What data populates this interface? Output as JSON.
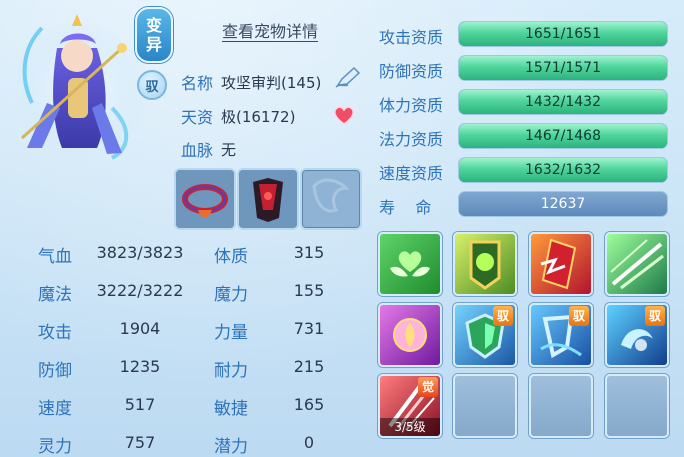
{
  "pet": {
    "variant_badge": [
      "变",
      "异"
    ],
    "tame_badge": "驭",
    "detail_link": "查看宠物详情",
    "name_label": "名称",
    "name_value": "攻坚审判(145)",
    "talent_label": "天资",
    "talent_value": "极(16172)",
    "bloodline_label": "血脉",
    "bloodline_value": "无"
  },
  "stats": {
    "left": [
      {
        "label": "气血",
        "value": "3823/3823"
      },
      {
        "label": "魔法",
        "value": "3222/3222"
      },
      {
        "label": "攻击",
        "value": "1904"
      },
      {
        "label": "防御",
        "value": "1235"
      },
      {
        "label": "速度",
        "value": "517"
      },
      {
        "label": "灵力",
        "value": "757"
      }
    ],
    "right": [
      {
        "label": "体质",
        "value": "315"
      },
      {
        "label": "魔力",
        "value": "155"
      },
      {
        "label": "力量",
        "value": "731"
      },
      {
        "label": "耐力",
        "value": "215"
      },
      {
        "label": "敏捷",
        "value": "165"
      },
      {
        "label": "潜力",
        "value": "0"
      }
    ]
  },
  "aptitudes": [
    {
      "label": "攻击资质",
      "text": "1651/1651",
      "fill": 1.0
    },
    {
      "label": "防御资质",
      "text": "1571/1571",
      "fill": 1.0
    },
    {
      "label": "体力资质",
      "text": "1432/1432",
      "fill": 1.0
    },
    {
      "label": "法力资质",
      "text": "1467/1468",
      "fill": 0.999
    },
    {
      "label": "速度资质",
      "text": "1632/1632",
      "fill": 1.0
    }
  ],
  "lifespan": {
    "label": "寿    命",
    "value": "12637"
  },
  "skills": {
    "tame_tag": "驭",
    "awake_tag": "觉",
    "awake_level": "3/5级"
  },
  "colors": {
    "label_blue": "#2f73b9",
    "bar_green": "#4fd59c",
    "tag_orange": "#e87410"
  }
}
